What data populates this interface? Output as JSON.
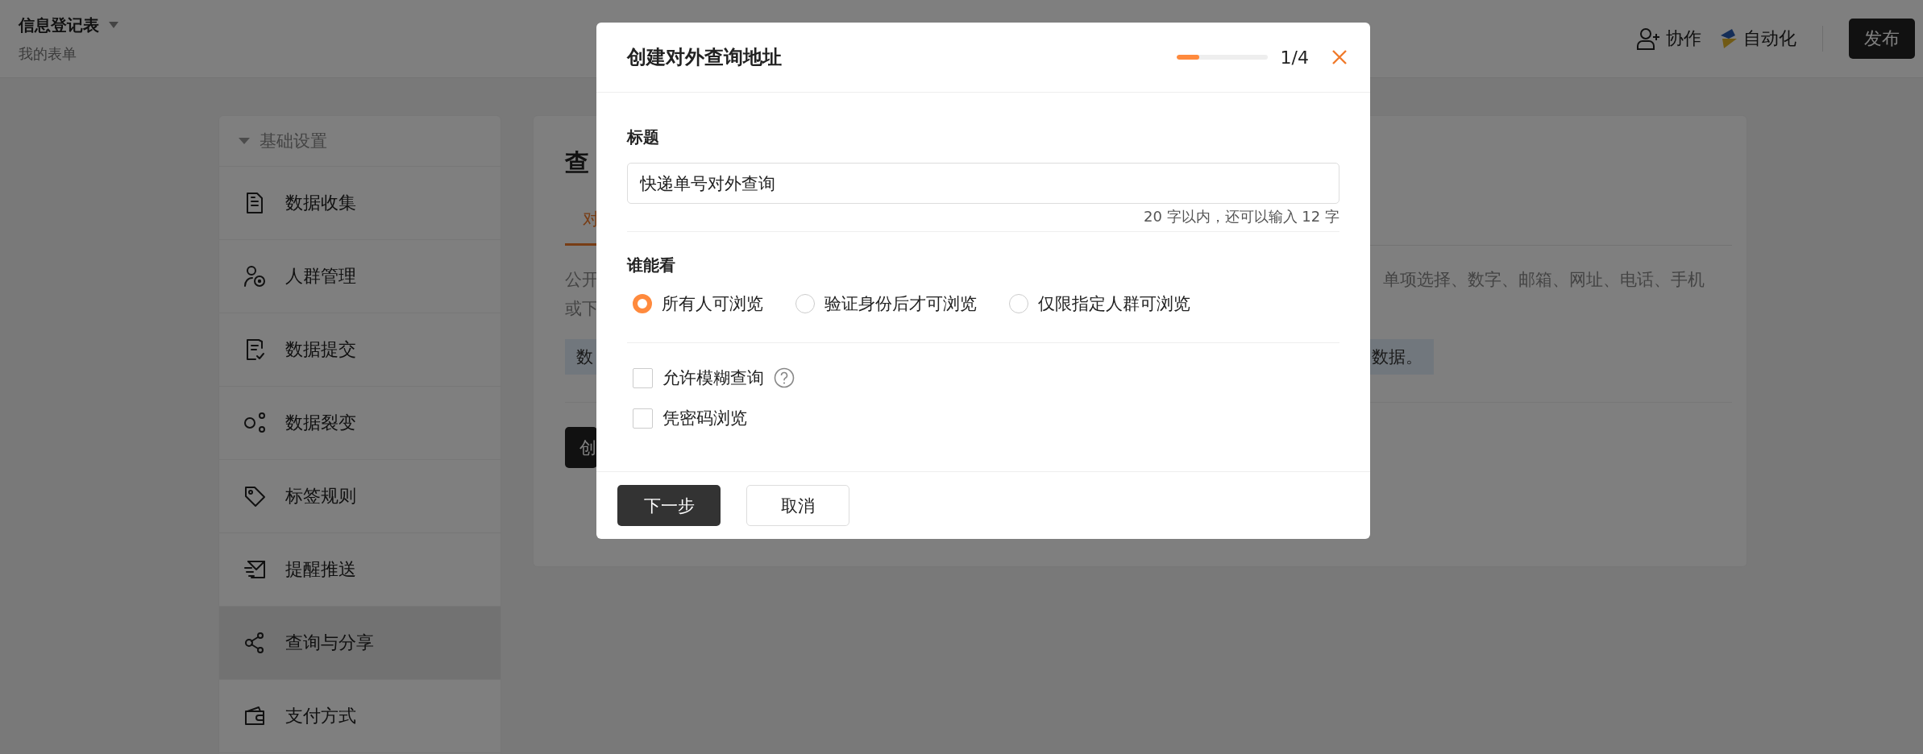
{
  "header": {
    "title": "信息登记表",
    "subtitle": "我的表单",
    "actions": [
      {
        "kind": "collab",
        "label": "协作"
      },
      {
        "kind": "automation",
        "label": "自动化"
      }
    ],
    "publish_button": "发布"
  },
  "sidebar": {
    "group": {
      "label": "基础设置",
      "expanded": true
    },
    "items": [
      {
        "kind": "doc",
        "label": "数据收集",
        "selected": false
      },
      {
        "kind": "people",
        "label": "人群管理",
        "selected": false
      },
      {
        "kind": "submit",
        "label": "数据提交",
        "selected": false
      },
      {
        "kind": "split",
        "label": "数据裂变",
        "selected": false
      },
      {
        "kind": "tag",
        "label": "标签规则",
        "selected": false
      },
      {
        "kind": "mail",
        "label": "提醒推送",
        "selected": false
      },
      {
        "kind": "share",
        "label": "查询与分享",
        "selected": true
      },
      {
        "kind": "wallet",
        "label": "支付方式",
        "selected": false
      }
    ]
  },
  "panel": {
    "title": "查",
    "tab": "对",
    "paragraph_left": "公开",
    "paragraph_left_2": "或下",
    "paragraph_right": "单项选择、数字、邮箱、网址、电话、手机",
    "note_left": "数",
    "note_right": "数据。",
    "button": "创"
  },
  "dialog": {
    "title": "创建对外查询地址",
    "progress": {
      "level": 0.25,
      "text": "1/4"
    },
    "title_field": {
      "label": "标题",
      "value": "快递单号对外查询",
      "counter": "20 字以内，还可以输入 12 字"
    },
    "visibility": {
      "label": "谁能看",
      "options": [
        {
          "label": "所有人可浏览",
          "selected": true
        },
        {
          "label": "验证身份后才可浏览",
          "selected": false
        },
        {
          "label": "仅限指定人群可浏览",
          "selected": false
        }
      ]
    },
    "options": [
      {
        "label": "允许模糊查询",
        "checked": false,
        "help": true
      },
      {
        "label": "凭密码浏览",
        "checked": false,
        "help": false
      }
    ],
    "buttons": [
      {
        "kind": "primary",
        "label": "下一步"
      },
      {
        "kind": "secondary",
        "label": "取消"
      }
    ]
  }
}
